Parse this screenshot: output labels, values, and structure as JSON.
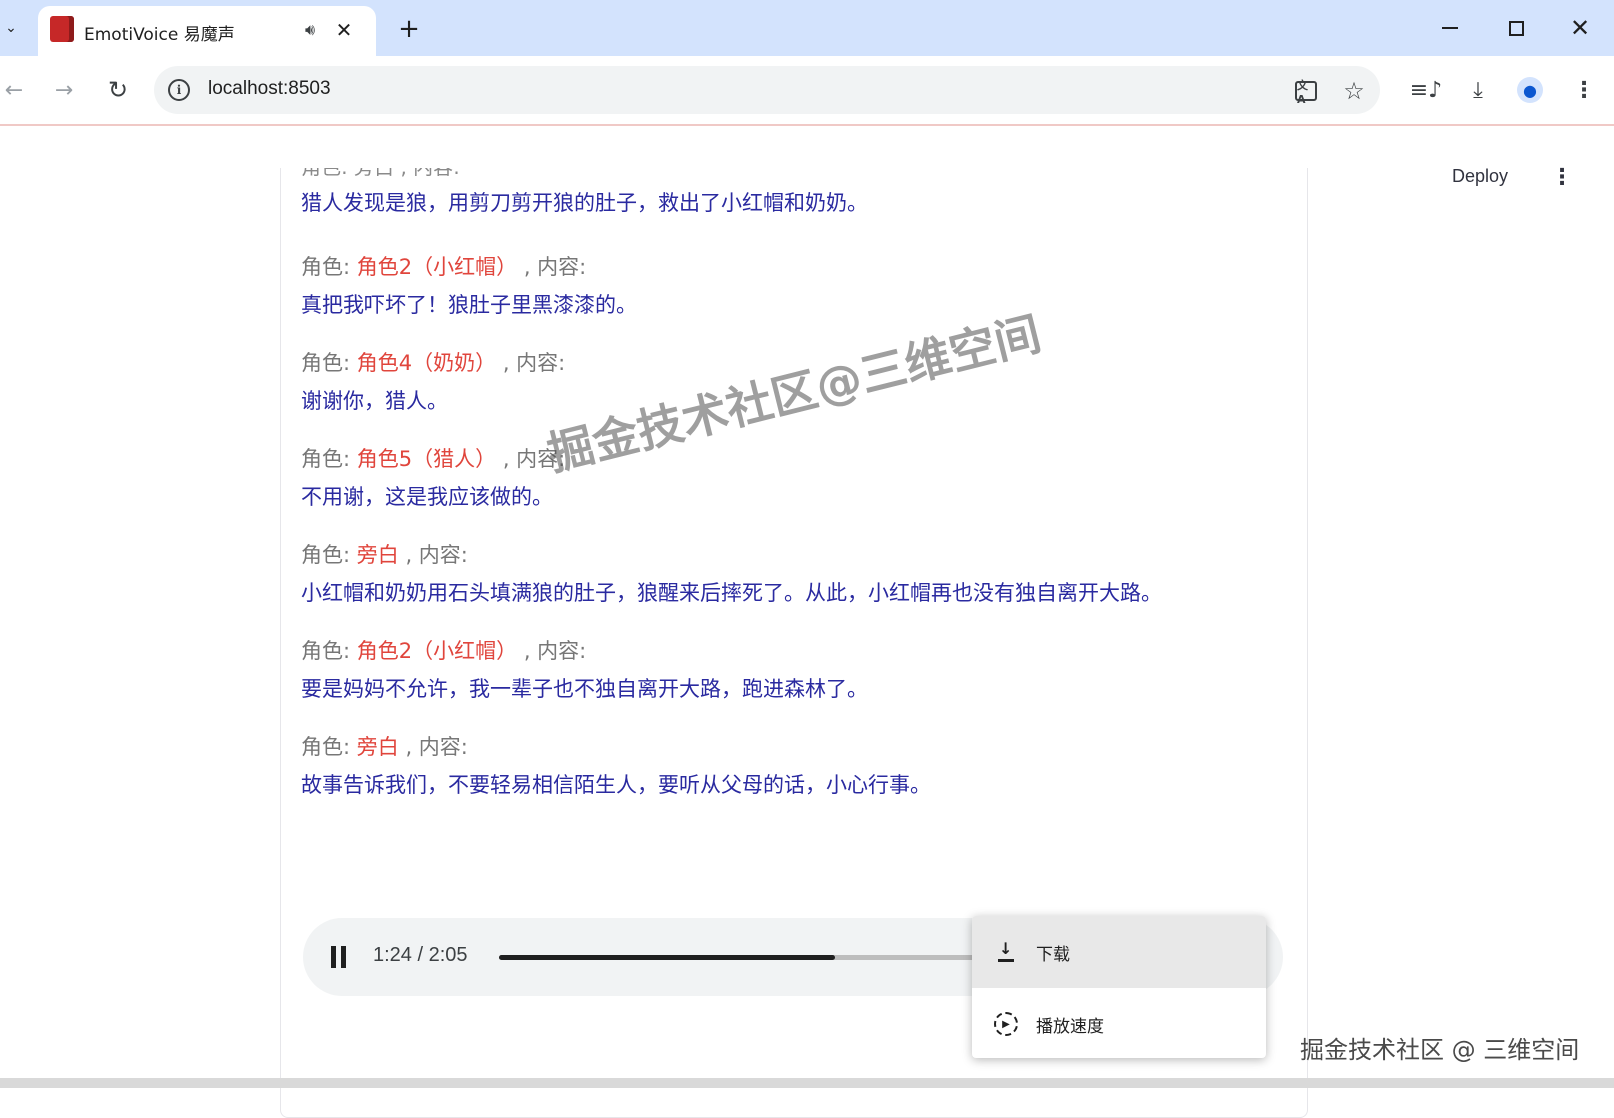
{
  "browser": {
    "tab": {
      "title": "EmotiVoice 易魔声"
    },
    "address": {
      "url": "localhost:8503"
    },
    "icons": {
      "tab_dropdown": "chevron-down-icon",
      "audio": "speaker-icon",
      "close": "close-icon",
      "new_tab": "plus-icon",
      "back": "arrow-left-icon",
      "forward": "arrow-right-icon",
      "reload": "reload-icon",
      "info": "info-icon",
      "translate": "translate-icon",
      "bookmark": "star-icon",
      "media": "media-control-icon",
      "downloads": "download-icon",
      "profile": "profile-icon",
      "menu": "kebab-menu-icon"
    }
  },
  "app": {
    "deploy_label": "Deploy",
    "cut_off_line": "角色: 旁白 , 内容:",
    "first_content": "猎人发现是狼，用剪刀剪开狼的肚子，救出了小红帽和奶奶。",
    "role_prefix": "角色: ",
    "content_suffix": " , 内容:",
    "entries": [
      {
        "role": "角色2（小红帽）",
        "content": "真把我吓坏了！狼肚子里黑漆漆的。"
      },
      {
        "role": "角色4（奶奶）",
        "content": "谢谢你，猎人。"
      },
      {
        "role": "角色5（猎人）",
        "content": "不用谢，这是我应该做的。"
      },
      {
        "role": "旁白",
        "content": "小红帽和奶奶用石头填满狼的肚子，狼醒来后摔死了。从此，小红帽再也没有独自离开大路。"
      },
      {
        "role": "角色2（小红帽）",
        "content": "要是妈妈不允许，我一辈子也不独自离开大路，跑进森林了。"
      },
      {
        "role": "旁白",
        "content": "故事告诉我们，不要轻易相信陌生人，要听从父母的话，小心行事。"
      }
    ],
    "player": {
      "time": "1:24 / 2:05",
      "progress": 0.672
    },
    "context_menu": {
      "items": [
        {
          "label": "下载",
          "icon": "download-icon"
        },
        {
          "label": "播放速度",
          "icon": "playback-speed-icon"
        }
      ]
    }
  },
  "watermarks": {
    "main": "掘金技术社区@三维空间",
    "corner": "掘金技术社区 @ 三维空间"
  },
  "colors": {
    "role_name": "#e0453c",
    "content_text": "#2a2aa0",
    "label_gray": "#777777",
    "tabbar_bg": "#d3e3fd"
  }
}
